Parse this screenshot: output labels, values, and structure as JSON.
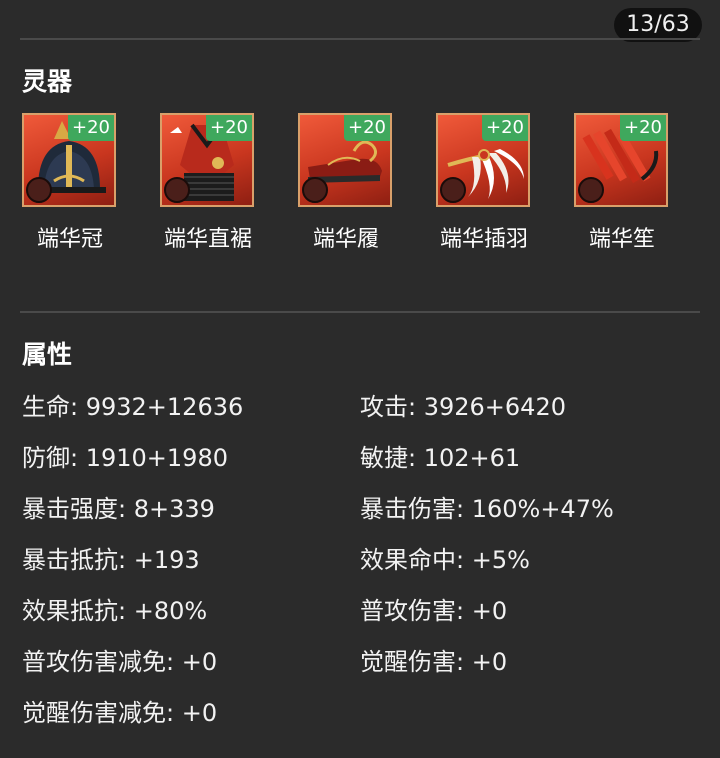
{
  "page_indicator": "13/63",
  "equipment": {
    "title": "灵器",
    "items": [
      {
        "name": "端华冠",
        "level": "+20",
        "icon": "crown-icon"
      },
      {
        "name": "端华直裾",
        "level": "+20",
        "icon": "robe-icon"
      },
      {
        "name": "端华履",
        "level": "+20",
        "icon": "shoe-icon"
      },
      {
        "name": "端华插羽",
        "level": "+20",
        "icon": "feather-icon"
      },
      {
        "name": "端华笙",
        "level": "+20",
        "icon": "sheng-instrument-icon"
      }
    ]
  },
  "attributes": {
    "title": "属性",
    "left": [
      "生命: 9932+12636",
      "防御: 1910+1980",
      "暴击强度: 8+339",
      "暴击抵抗: +193",
      "效果抵抗: +80%",
      "普攻伤害减免: +0",
      "觉醒伤害减免: +0"
    ],
    "right": [
      "攻击: 3926+6420",
      "敏捷: 102+61",
      "暴击伤害: 160%+47%",
      "效果命中: +5%",
      "普攻伤害: +0",
      "觉醒伤害: +0"
    ]
  },
  "colors": {
    "background": "#2b2b2b",
    "level_badge": "#3fa85d",
    "item_frame": "#d9a06a"
  }
}
